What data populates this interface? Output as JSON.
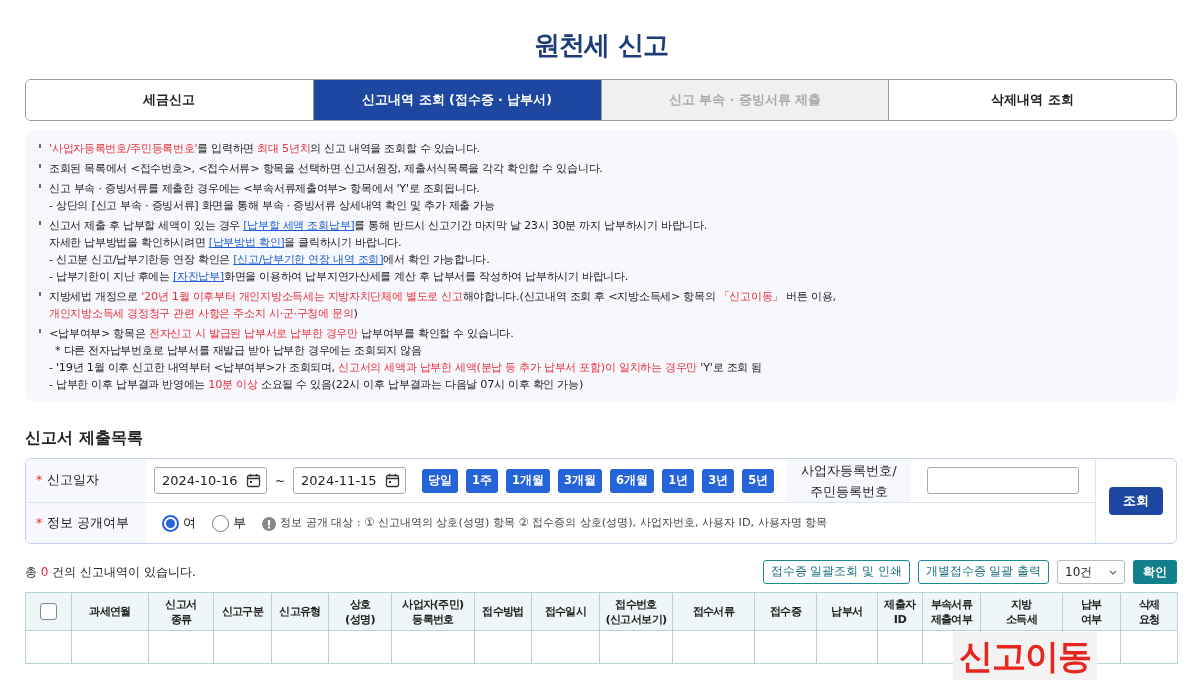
{
  "title": "원천세 신고",
  "tabs": [
    {
      "label": "세금신고",
      "selected": false,
      "disabled": false
    },
    {
      "label": "신고내역 조회 (접수증 · 납부서)",
      "selected": true,
      "disabled": false
    },
    {
      "label": "신고 부속 · 증빙서류 제출",
      "selected": false,
      "disabled": true
    },
    {
      "label": "삭제내역 조회",
      "selected": false,
      "disabled": false
    }
  ],
  "notices": [
    [
      {
        "kind": "first",
        "segments": [
          {
            "kind": "red",
            "t": "'사업자등록번호/주민등록번호'"
          },
          {
            "kind": "text",
            "t": "를 입력하면 "
          },
          {
            "kind": "red",
            "t": "최대 5년치"
          },
          {
            "kind": "text",
            "t": "의 신고 내역을 조회할 수 있습니다."
          }
        ]
      }
    ],
    [
      {
        "kind": "first",
        "segments": [
          {
            "kind": "text",
            "t": "조회된 목록에서 <접수번호>, <접수서류> 항목을 선택하면 신고서원장, 제출서식목록을 각각 확인할 수 있습니다."
          }
        ]
      }
    ],
    [
      {
        "kind": "first",
        "segments": [
          {
            "kind": "text",
            "t": "신고 부속 · 증빙서류를 제출한 경우에는 <부속서류제출여부> 항목에서 'Y'로 조회됩니다."
          }
        ]
      },
      {
        "kind": "cont",
        "segments": [
          {
            "kind": "text",
            "t": "- 상단의 [신고 부속 · 증빙서류] 화면을 통해 부속 · 증빙서류 상세내역 확인 및 추가 제출 가능"
          }
        ]
      }
    ],
    [
      {
        "kind": "first",
        "segments": [
          {
            "kind": "text",
            "t": "신고서 제출 후 납부할 세액이 있는 경우 "
          },
          {
            "kind": "link",
            "t": "[납부할 세액 조회납부]"
          },
          {
            "kind": "text",
            "t": "를 통해 반드시 신고기간 마지막 날 23시 30분 까지 납부하시기 바랍니다."
          }
        ]
      },
      {
        "kind": "cont",
        "segments": [
          {
            "kind": "text",
            "t": "자세한 납부방법을 확인하시려면 "
          },
          {
            "kind": "link",
            "t": "[납부방법 확인]"
          },
          {
            "kind": "text",
            "t": "을 클릭하시기 바랍니다."
          }
        ]
      },
      {
        "kind": "cont",
        "segments": [
          {
            "kind": "text",
            "t": "- 신고분 신고/납부기한등 연장 확인은 "
          },
          {
            "kind": "link",
            "t": "[신고/납부기한 연장 내역 조회]"
          },
          {
            "kind": "text",
            "t": "에서 확인 가능합니다."
          }
        ]
      },
      {
        "kind": "cont",
        "segments": [
          {
            "kind": "text",
            "t": "- 납부기한이 지난 후에는 "
          },
          {
            "kind": "link",
            "t": "[자진납부]"
          },
          {
            "kind": "text",
            "t": "화면을 이용하여 납부지연가산세를 계산 후 납부서를 작성하여 납부하시기 바랍니다."
          }
        ]
      }
    ],
    [
      {
        "kind": "first",
        "segments": [
          {
            "kind": "text",
            "t": "지방세법 개정으로 "
          },
          {
            "kind": "red",
            "t": "'20년 1월 이후부터 개인지방소득세는 지방자치단체에 별도로 신고"
          },
          {
            "kind": "text",
            "t": "해야합니다.(신고내역 조회 후 <지방소득세> 항목의 "
          },
          {
            "kind": "red",
            "t": "「신고이동」"
          },
          {
            "kind": "text",
            "t": " 버튼 이용,"
          }
        ]
      },
      {
        "kind": "cont",
        "segments": [
          {
            "kind": "red",
            "t": "개인지방소득세 경정청구 관련 사항은 주소지 시·군·구청에 문의"
          },
          {
            "kind": "text",
            "t": ")"
          }
        ]
      }
    ],
    [
      {
        "kind": "first",
        "segments": [
          {
            "kind": "text",
            "t": "<납부여부> 항목은 "
          },
          {
            "kind": "red",
            "t": "전자신고 시 발급된 납부서로 납부한 경우만"
          },
          {
            "kind": "text",
            "t": " 납부여부를 확인할 수 있습니다."
          }
        ]
      },
      {
        "kind": "note",
        "segments": [
          {
            "kind": "text",
            "t": "* 다른 전자납부번호로 납부서를 재발급 받아 납부한 경우에는 조회되지 않음"
          }
        ]
      },
      {
        "kind": "cont",
        "segments": [
          {
            "kind": "text",
            "t": "- '19년 1월 이후 신고한 내역부터 <납부여부>가 조회되며, "
          },
          {
            "kind": "red",
            "t": "신고서의 세액과 납부한 세액(분납 등 추가 납부서 포함)이 일치하는 경우만"
          },
          {
            "kind": "text",
            "t": " 'Y'로 조회 됨"
          }
        ]
      },
      {
        "kind": "cont",
        "segments": [
          {
            "kind": "text",
            "t": "- 납부한 이후 납부결과 반영에는 "
          },
          {
            "kind": "red",
            "t": "10분 이상"
          },
          {
            "kind": "text",
            "t": " 소요될 수 있음(22시 이후 납부결과는 다음날 07시 이후 확인 가능)"
          }
        ]
      }
    ]
  ],
  "list_title": "신고서 제출목록",
  "search": {
    "date": {
      "required_mark": "*",
      "label": "신고일자",
      "from": "2024-10-16",
      "separator": "~",
      "to": "2024-11-15",
      "periods": [
        {
          "label": "당일",
          "selected": false
        },
        {
          "label": "1주",
          "selected": false
        },
        {
          "label": "1개월",
          "selected": false
        },
        {
          "label": "3개월",
          "selected": false
        },
        {
          "label": "6개월",
          "selected": false
        },
        {
          "label": "1년",
          "selected": false
        },
        {
          "label": "3년",
          "selected": false
        },
        {
          "label": "5년",
          "selected": false
        }
      ]
    },
    "id_label": "사업자등록번호/\n주민등록번호",
    "disclosure": {
      "required_mark": "*",
      "label": "정보 공개여부",
      "options": [
        {
          "label": "여",
          "selected": true
        },
        {
          "label": "부",
          "selected": false
        }
      ],
      "info": "정보 공개 대상 : ① 신고내역의 상호(성명) 항목 ② 접수증의 상호(성명), 사업자번호, 사용자 ID, 사용자명 항목"
    },
    "submit": "조회"
  },
  "count": {
    "prefix": "총 ",
    "value": "0",
    "suffix": " 건의 신고내역이 있습니다."
  },
  "actions": [
    "접수증 일괄조회 및 인쇄",
    "개별접수증 일괄 출력"
  ],
  "page_size": "10건",
  "confirm": "확인",
  "table": {
    "columns": [
      {
        "kind": "checkbox",
        "checked": false
      },
      {
        "kind": "text",
        "label": "과세연월"
      },
      {
        "kind": "text",
        "label": "신고서\n종류"
      },
      {
        "kind": "text",
        "label": "신고구분"
      },
      {
        "kind": "text",
        "label": "신고유형"
      },
      {
        "kind": "text",
        "label": "상호\n(성명)"
      },
      {
        "kind": "text",
        "label": "사업자(주민)\n등록번호"
      },
      {
        "kind": "text",
        "label": "접수방법"
      },
      {
        "kind": "text",
        "label": "접수일시"
      },
      {
        "kind": "text",
        "label": "접수번호\n(신고서보기)"
      },
      {
        "kind": "text",
        "label": "접수서류"
      },
      {
        "kind": "text",
        "label": "접수증"
      },
      {
        "kind": "text",
        "label": "납부서"
      },
      {
        "kind": "text",
        "label": "제출자\nID"
      },
      {
        "kind": "text",
        "label": "부속서류\n제출여부"
      },
      {
        "kind": "text",
        "label": "지방\n소득세"
      },
      {
        "kind": "text",
        "label": "납부\n여부"
      },
      {
        "kind": "text",
        "label": "삭제\n요청"
      }
    ]
  },
  "callout": "신고이동"
}
